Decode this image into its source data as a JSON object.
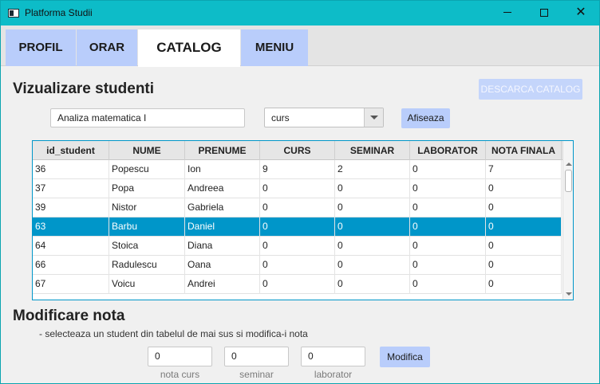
{
  "window": {
    "title": "Platforma Studii"
  },
  "tabs": [
    {
      "label": "PROFIL"
    },
    {
      "label": "ORAR"
    },
    {
      "label": "CATALOG"
    },
    {
      "label": "MENIU"
    }
  ],
  "view_section": {
    "title": "Vizualizare studenti",
    "download_button": "DESCARCA CATALOG",
    "course_input_value": "Analiza matematica I",
    "type_select_value": "curs",
    "show_button": "Afiseaza"
  },
  "table": {
    "columns": [
      "id_student",
      "NUME",
      "PRENUME",
      "CURS",
      "SEMINAR",
      "LABORATOR",
      "NOTA FINALA"
    ],
    "rows": [
      [
        "36",
        "Popescu",
        "Ion",
        "9",
        "2",
        "0",
        "7"
      ],
      [
        "37",
        "Popa",
        "Andreea",
        "0",
        "0",
        "0",
        "0"
      ],
      [
        "39",
        "Nistor",
        "Gabriela",
        "0",
        "0",
        "0",
        "0"
      ],
      [
        "63",
        "Barbu",
        "Daniel",
        "0",
        "0",
        "0",
        "0"
      ],
      [
        "64",
        "Stoica",
        "Diana",
        "0",
        "0",
        "0",
        "0"
      ],
      [
        "66",
        "Radulescu",
        "Oana",
        "0",
        "0",
        "0",
        "0"
      ],
      [
        "67",
        "Voicu",
        "Andrei",
        "0",
        "0",
        "0",
        "0"
      ]
    ],
    "selected_row_index": 3
  },
  "edit_section": {
    "title": "Modificare nota",
    "hint": "- selecteaza un student din tabelul de mai sus si modifica-i nota",
    "fields": [
      {
        "value": "0",
        "label": "nota curs"
      },
      {
        "value": "0",
        "label": "seminar"
      },
      {
        "value": "0",
        "label": "laborator"
      }
    ],
    "modify_button": "Modifica"
  },
  "colors": {
    "titlebar": "#0dbcc8",
    "tab_inactive": "#b9cdfb",
    "selection": "#0096c9"
  }
}
